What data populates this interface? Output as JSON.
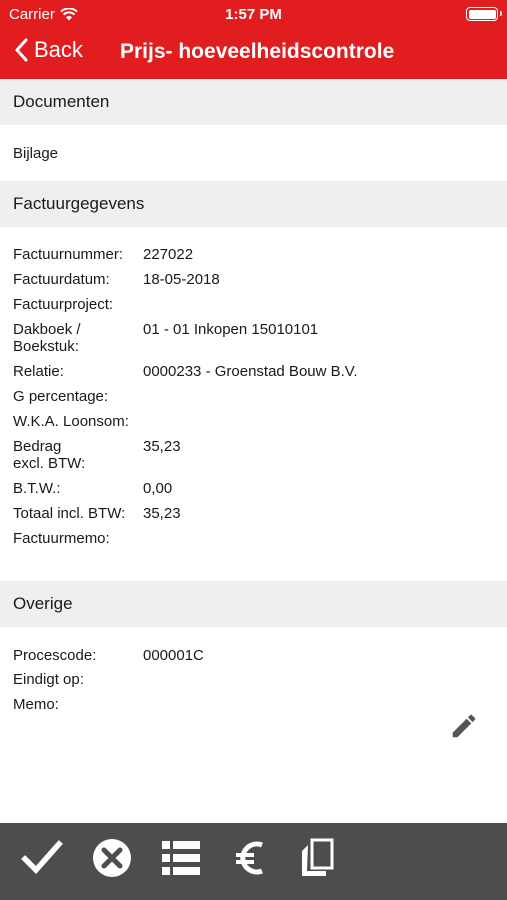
{
  "status_bar": {
    "carrier": "Carrier",
    "time": "1:57 PM"
  },
  "nav": {
    "back_label": "Back",
    "title": "Prijs- hoeveelheidscontrole"
  },
  "documenten": {
    "header": "Documenten",
    "items": [
      "Bijlage"
    ]
  },
  "factuurgegevens": {
    "header": "Factuurgegevens",
    "fields": [
      {
        "label": "Factuurnummer:",
        "value": "227022"
      },
      {
        "label": "Factuurdatum:",
        "value": "18-05-2018"
      },
      {
        "label": "Factuurproject:",
        "value": ""
      },
      {
        "label": "Dakboek /\nBoekstuk:",
        "value": "01 - 01 Inkopen  15010101"
      },
      {
        "label": "Relatie:",
        "value": "0000233 - Groenstad Bouw B.V."
      },
      {
        "label": "G percentage:",
        "value": ""
      },
      {
        "label": "W.K.A. Loonsom:",
        "value": ""
      },
      {
        "label": "Bedrag\nexcl. BTW:",
        "value": "35,23"
      },
      {
        "label": "B.T.W.:",
        "value": "0,00"
      },
      {
        "label": "Totaal incl. BTW:",
        "value": "35,23"
      },
      {
        "label": "Factuurmemo:",
        "value": ""
      }
    ]
  },
  "overige": {
    "header": "Overige",
    "fields": [
      {
        "label": "Procescode:",
        "value": "000001C"
      },
      {
        "label": "Eindigt op:",
        "value": ""
      },
      {
        "label": "Memo:",
        "value": ""
      }
    ]
  },
  "toolbar": {
    "icons": [
      "checkmark-icon",
      "cancel-circle-icon",
      "list-icon",
      "euro-icon",
      "copy-icon"
    ]
  },
  "colors": {
    "header": "#e11d20",
    "section_bg": "#efeff1",
    "toolbar": "#4d4d4d",
    "icon": "#ffffff"
  }
}
